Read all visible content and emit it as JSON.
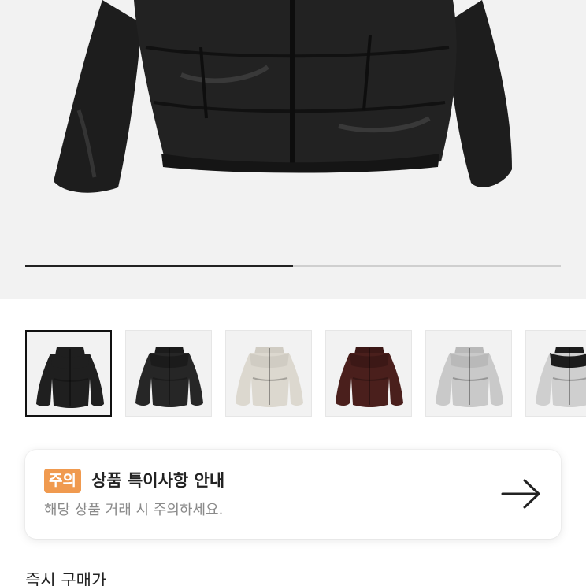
{
  "gallery": {
    "progress": 0.5,
    "thumbnails": [
      {
        "name": "black-nuptse-main",
        "body": "#1f1f1f",
        "yoke": "#1f1f1f",
        "selected": true
      },
      {
        "name": "black-glossy",
        "body": "#262626",
        "yoke": "#1b1b1b",
        "selected": false
      },
      {
        "name": "cream",
        "body": "#dcd8cf",
        "yoke": "#d0ccc3",
        "selected": false
      },
      {
        "name": "burgundy",
        "body": "#4a1f1c",
        "yoke": "#3c1816",
        "selected": false
      },
      {
        "name": "silver",
        "body": "#c9c9c9",
        "yoke": "#b9b9b9",
        "selected": false
      },
      {
        "name": "silver-black",
        "body": "#cfcfcf",
        "yoke": "#1c1c1c",
        "selected": false
      }
    ]
  },
  "notice": {
    "badge": "주의",
    "title": "상품 특이사항 안내",
    "subtitle": "해당 상품 거래 시 주의하세요.",
    "arrow_icon": "arrow-right-icon",
    "badge_color": "#f09a4f"
  },
  "purchase": {
    "label": "즉시 구매가"
  }
}
